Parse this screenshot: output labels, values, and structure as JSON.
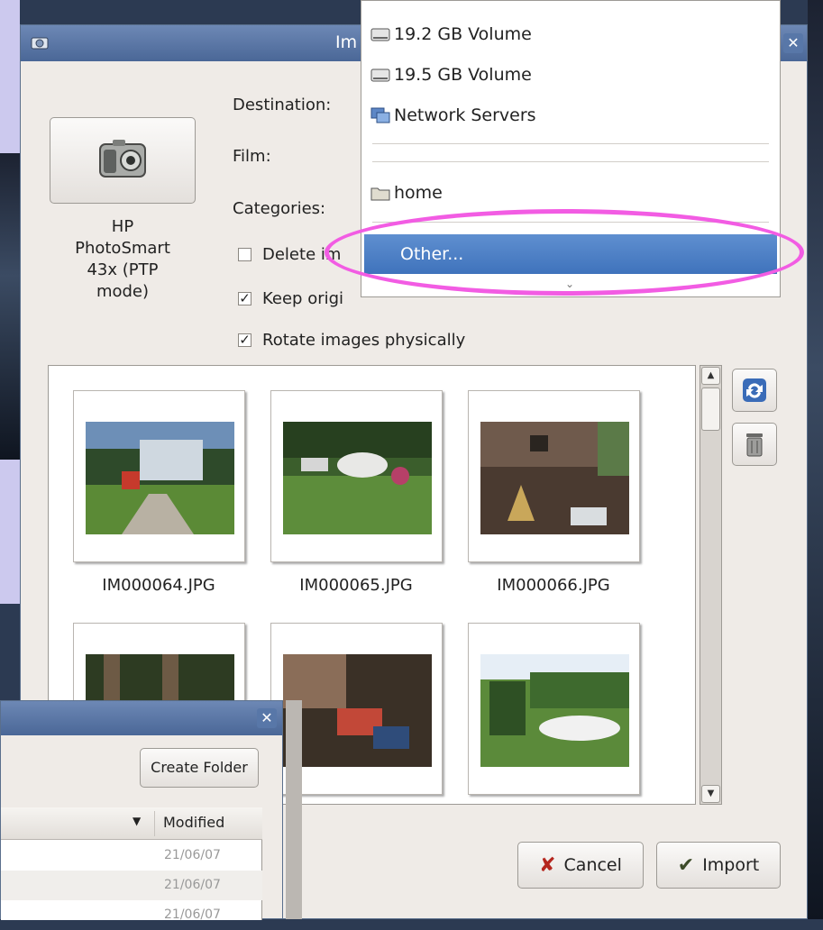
{
  "main_window": {
    "title": "Im",
    "camera_name": "HP\nPhotoSmart\n43x (PTP\nmode)",
    "labels": {
      "destination": "Destination:",
      "film": "Film:",
      "categories": "Categories:"
    },
    "checkboxes": [
      {
        "label": "Delete im",
        "checked": false
      },
      {
        "label": "Keep origi",
        "checked": true
      },
      {
        "label": "Rotate images physically",
        "checked": true
      }
    ],
    "thumbnails": [
      {
        "name": "IM000064.JPG"
      },
      {
        "name": "IM000065.JPG"
      },
      {
        "name": "IM000066.JPG"
      },
      {
        "name": ""
      },
      {
        "name": ""
      },
      {
        "name": ""
      }
    ],
    "buttons": {
      "cancel": "Cancel",
      "import": "Import"
    }
  },
  "dropdown": {
    "items": [
      {
        "label": "19.2 GB Volume",
        "icon": "drive-icon"
      },
      {
        "label": "19.5 GB Volume",
        "icon": "drive-icon"
      },
      {
        "label": "Network Servers",
        "icon": "network-icon"
      },
      {
        "label": "home",
        "icon": "folder-icon"
      }
    ],
    "selected": "Other..."
  },
  "file_chooser": {
    "create_folder": "Create Folder",
    "column_modified": "Modified",
    "rows": [
      {
        "modified": "21/06/07"
      },
      {
        "modified": "21/06/07"
      },
      {
        "modified": "21/06/07"
      }
    ]
  },
  "colors": {
    "titlebar": "#5877a8",
    "selection": "#4a7cc4",
    "highlight_ellipse": "#f25ce3"
  }
}
